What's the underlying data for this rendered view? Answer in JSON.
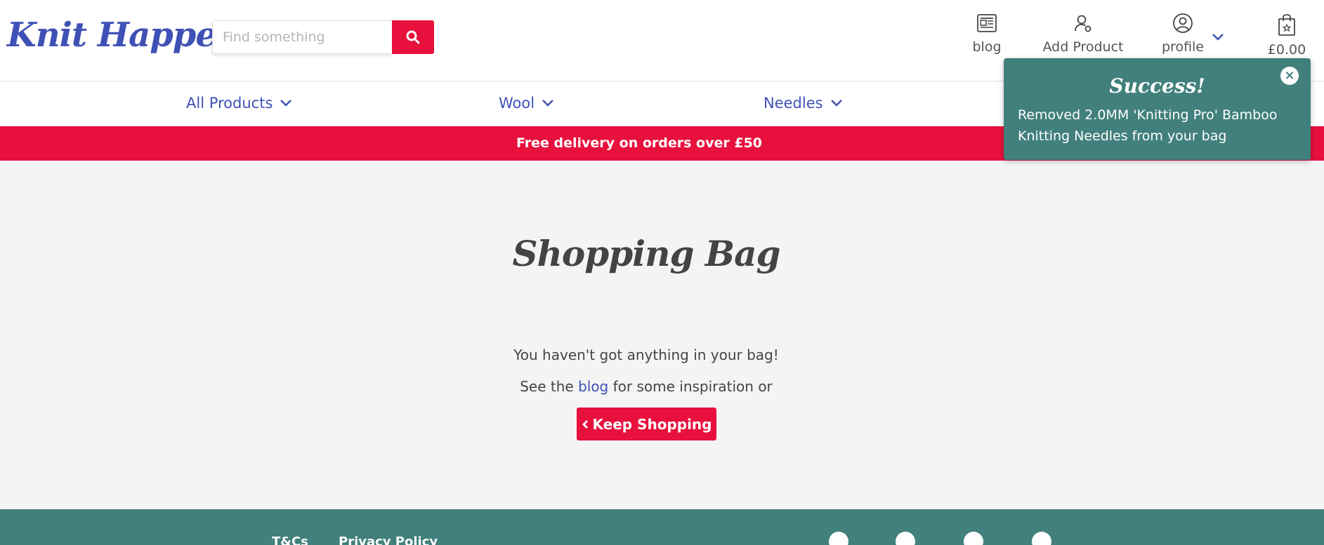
{
  "brand": {
    "logo_text": "Knit Happens",
    "accent": "#3f51b5",
    "primary": "#e8103c",
    "teal": "#41807c"
  },
  "search": {
    "placeholder": "Find something",
    "icon": "search-icon"
  },
  "nav": {
    "blog": {
      "label": "blog",
      "icon": "newspaper-icon"
    },
    "add_product": {
      "label": "Add Product",
      "icon": "user-cog-icon"
    },
    "profile": {
      "label": "profile",
      "icon": "user-circle-icon"
    },
    "bag": {
      "label": "£0.00",
      "icon": "shopping-bag-icon"
    }
  },
  "categories": [
    {
      "label": "All Products"
    },
    {
      "label": "Wool"
    },
    {
      "label": "Needles"
    }
  ],
  "promo": {
    "text": "Free delivery on orders over £50"
  },
  "main": {
    "title": "Shopping Bag",
    "empty_message": "You haven't got anything in your bag!",
    "see_prefix": "See the",
    "see_link": "blog",
    "see_suffix": "for some inspiration or",
    "keep_shopping": "Keep Shopping"
  },
  "footer": {
    "links": [
      {
        "label": "T&Cs"
      },
      {
        "label": "Privacy Policy"
      }
    ],
    "social": [
      "facebook-icon",
      "instagram-icon",
      "github-icon",
      "pinterest-icon"
    ]
  },
  "toast": {
    "title": "Success!",
    "message": "Removed 2.0MM 'Knitting Pro' Bamboo Knitting Needles from your bag"
  }
}
